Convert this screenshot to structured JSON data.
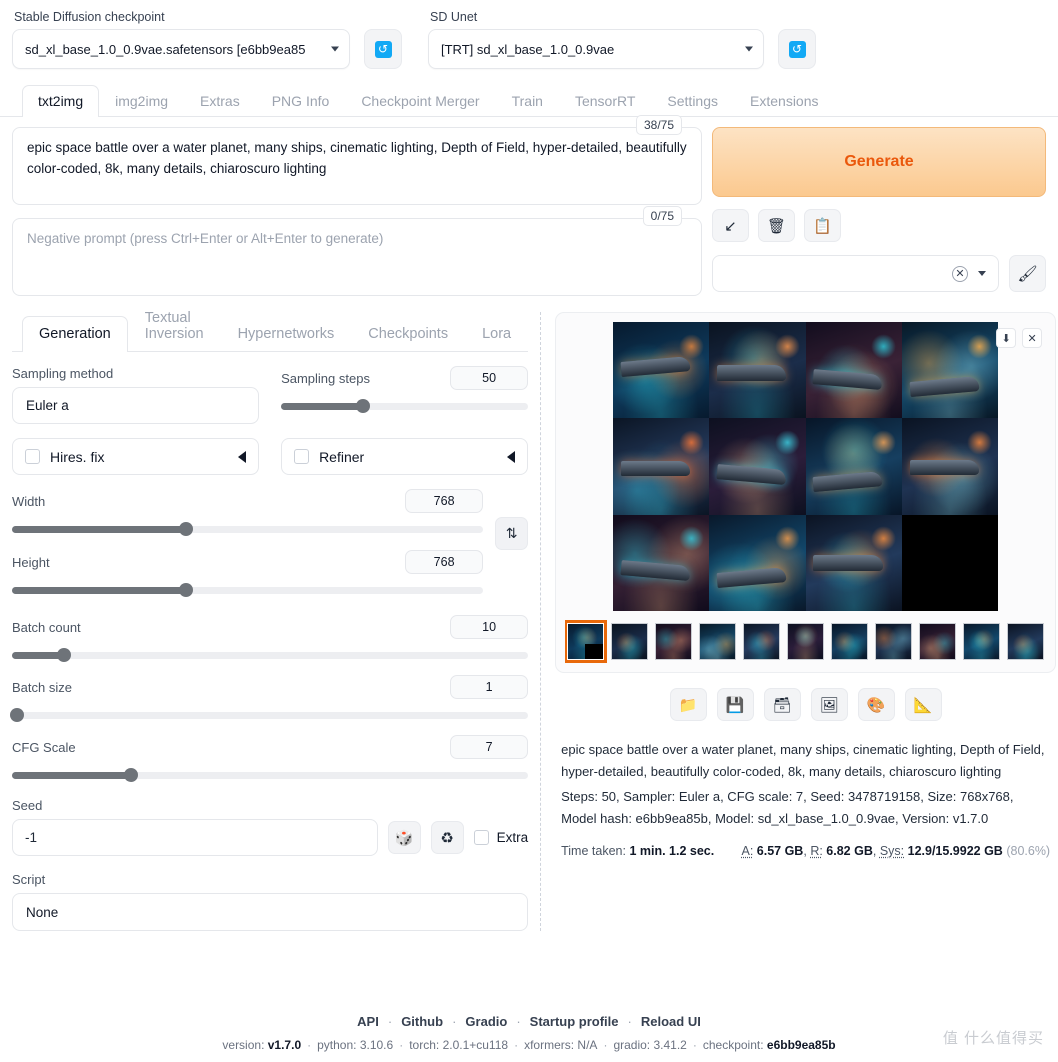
{
  "header": {
    "checkpoint_label": "Stable Diffusion checkpoint",
    "checkpoint_value": "sd_xl_base_1.0_0.9vae.safetensors [e6bb9ea85",
    "unet_label": "SD Unet",
    "unet_value": "[TRT] sd_xl_base_1.0_0.9vae",
    "refresh_glyph": "↺"
  },
  "main_tabs": [
    {
      "label": "txt2img",
      "active": true
    },
    {
      "label": "img2img",
      "active": false
    },
    {
      "label": "Extras",
      "active": false
    },
    {
      "label": "PNG Info",
      "active": false
    },
    {
      "label": "Checkpoint Merger",
      "active": false
    },
    {
      "label": "Train",
      "active": false
    },
    {
      "label": "TensorRT",
      "active": false
    },
    {
      "label": "Settings",
      "active": false
    },
    {
      "label": "Extensions",
      "active": false
    }
  ],
  "prompt": {
    "value": "epic space battle over a water planet, many ships, cinematic lighting, Depth of Field, hyper-detailed, beautifully color-coded, 8k, many details, chiaroscuro lighting",
    "token_count": "38/75",
    "negative_placeholder": "Negative prompt (press Ctrl+Enter or Alt+Enter to generate)",
    "negative_token_count": "0/75"
  },
  "actions": {
    "generate_label": "Generate",
    "arrow_icon": "↙",
    "trash_icon": "🗑",
    "clipboard_icon": "📋",
    "clear_icon": "✕",
    "brush_icon": "🖌",
    "styles_value": ""
  },
  "sub_tabs": [
    {
      "label": "Generation",
      "active": true
    },
    {
      "label": "Textual Inversion",
      "active": false
    },
    {
      "label": "Hypernetworks",
      "active": false
    },
    {
      "label": "Checkpoints",
      "active": false
    },
    {
      "label": "Lora",
      "active": false
    }
  ],
  "controls": {
    "sampling_method_label": "Sampling method",
    "sampling_method_value": "Euler a",
    "sampling_steps_label": "Sampling steps",
    "sampling_steps_value": "50",
    "sampling_steps_pct": 33,
    "hires_fix_label": "Hires. fix",
    "refiner_label": "Refiner",
    "width_label": "Width",
    "width_value": "768",
    "width_pct": 37,
    "height_label": "Height",
    "height_value": "768",
    "height_pct": 37,
    "swap_icon": "⇅",
    "batch_count_label": "Batch count",
    "batch_count_value": "10",
    "batch_count_pct": 10,
    "batch_size_label": "Batch size",
    "batch_size_value": "1",
    "batch_size_pct": 1,
    "cfg_scale_label": "CFG Scale",
    "cfg_scale_value": "7",
    "cfg_scale_pct": 23,
    "seed_label": "Seed",
    "seed_value": "-1",
    "dice_icon": "🎲",
    "recycle_icon": "♻",
    "extra_label": "Extra",
    "script_label": "Script",
    "script_value": "None"
  },
  "gallery": {
    "download_icon": "⬇",
    "close_icon": "✕",
    "selected_thumb_index": 0,
    "thumb_count": 11,
    "action_buttons": [
      {
        "name": "open-folder",
        "icon": "📁"
      },
      {
        "name": "save",
        "icon": "💾"
      },
      {
        "name": "save-zip",
        "icon": "🗃"
      },
      {
        "name": "send-to-img2img",
        "icon": "🖼"
      },
      {
        "name": "send-to-inpaint",
        "icon": "🎨"
      },
      {
        "name": "send-to-extras",
        "icon": "📐"
      }
    ]
  },
  "result_info": {
    "prompt": "epic space battle over a water planet, many ships, cinematic lighting, Depth of Field, hyper-detailed, beautifully color-coded, 8k, many details, chiaroscuro lighting",
    "params": "Steps: 50, Sampler: Euler a, CFG scale: 7, Seed: 3478719158, Size: 768x768, Model hash: e6bb9ea85b, Model: sd_xl_base_1.0_0.9vae, Version: v1.7.0",
    "time_label": "Time taken:",
    "time_value": "1 min. 1.2 sec.",
    "mem_a_label": "A:",
    "mem_a_value": "6.57 GB",
    "mem_r_label": "R:",
    "mem_r_value": "6.82 GB",
    "mem_sys_label": "Sys:",
    "mem_sys_value": "12.9/15.9922 GB",
    "mem_sys_pct": "(80.6%)"
  },
  "footer": {
    "links": [
      "API",
      "Github",
      "Gradio",
      "Startup profile",
      "Reload UI"
    ],
    "version_label": "version:",
    "version_value": "v1.7.0",
    "python_label": "python:",
    "python_value": "3.10.6",
    "torch_label": "torch:",
    "torch_value": "2.0.1+cu118",
    "xformers_label": "xformers:",
    "xformers_value": "N/A",
    "gradio_label": "gradio:",
    "gradio_value": "3.41.2",
    "checkpoint_label": "checkpoint:",
    "checkpoint_value": "e6bb9ea85b",
    "watermark": "值 什么值得买"
  },
  "chart_data": null
}
